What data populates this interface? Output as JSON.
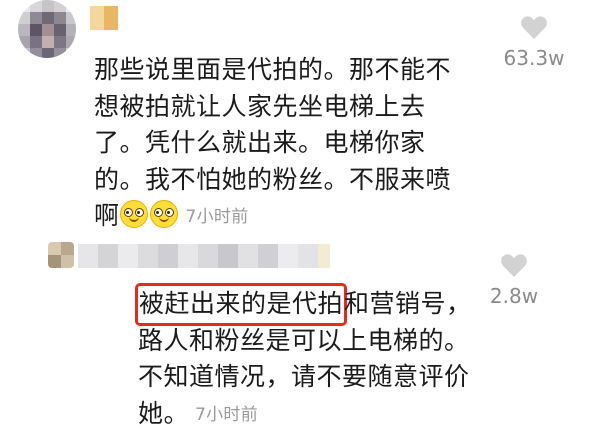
{
  "comments": [
    {
      "lines": [
        "那些说里面是代拍的。那不能不",
        "想被拍就让人家先坐电梯上去",
        "了。凭什么就出来。电梯你家",
        "的。我不怕她的粉丝。不服来喷"
      ],
      "last_line": "啊",
      "emoji": [
        "smiling-face",
        "smiling-face"
      ],
      "time": "7小时前",
      "likes": "63.3w",
      "heart_icon": "heart-icon"
    },
    {
      "highlighted": "被赶出来的是代拍",
      "line1_rest": "和营销号，",
      "lines": [
        "路人和粉丝是可以上电梯的。",
        "不知道情况，请不要随意评价"
      ],
      "last_line": "她。",
      "time": "7小时前",
      "likes": "2.8w",
      "heart_icon": "heart-icon"
    }
  ],
  "colors": {
    "highlight_border": "#e8291c",
    "meta_text": "#9a9a9a",
    "heart": "#d2d2d2"
  }
}
